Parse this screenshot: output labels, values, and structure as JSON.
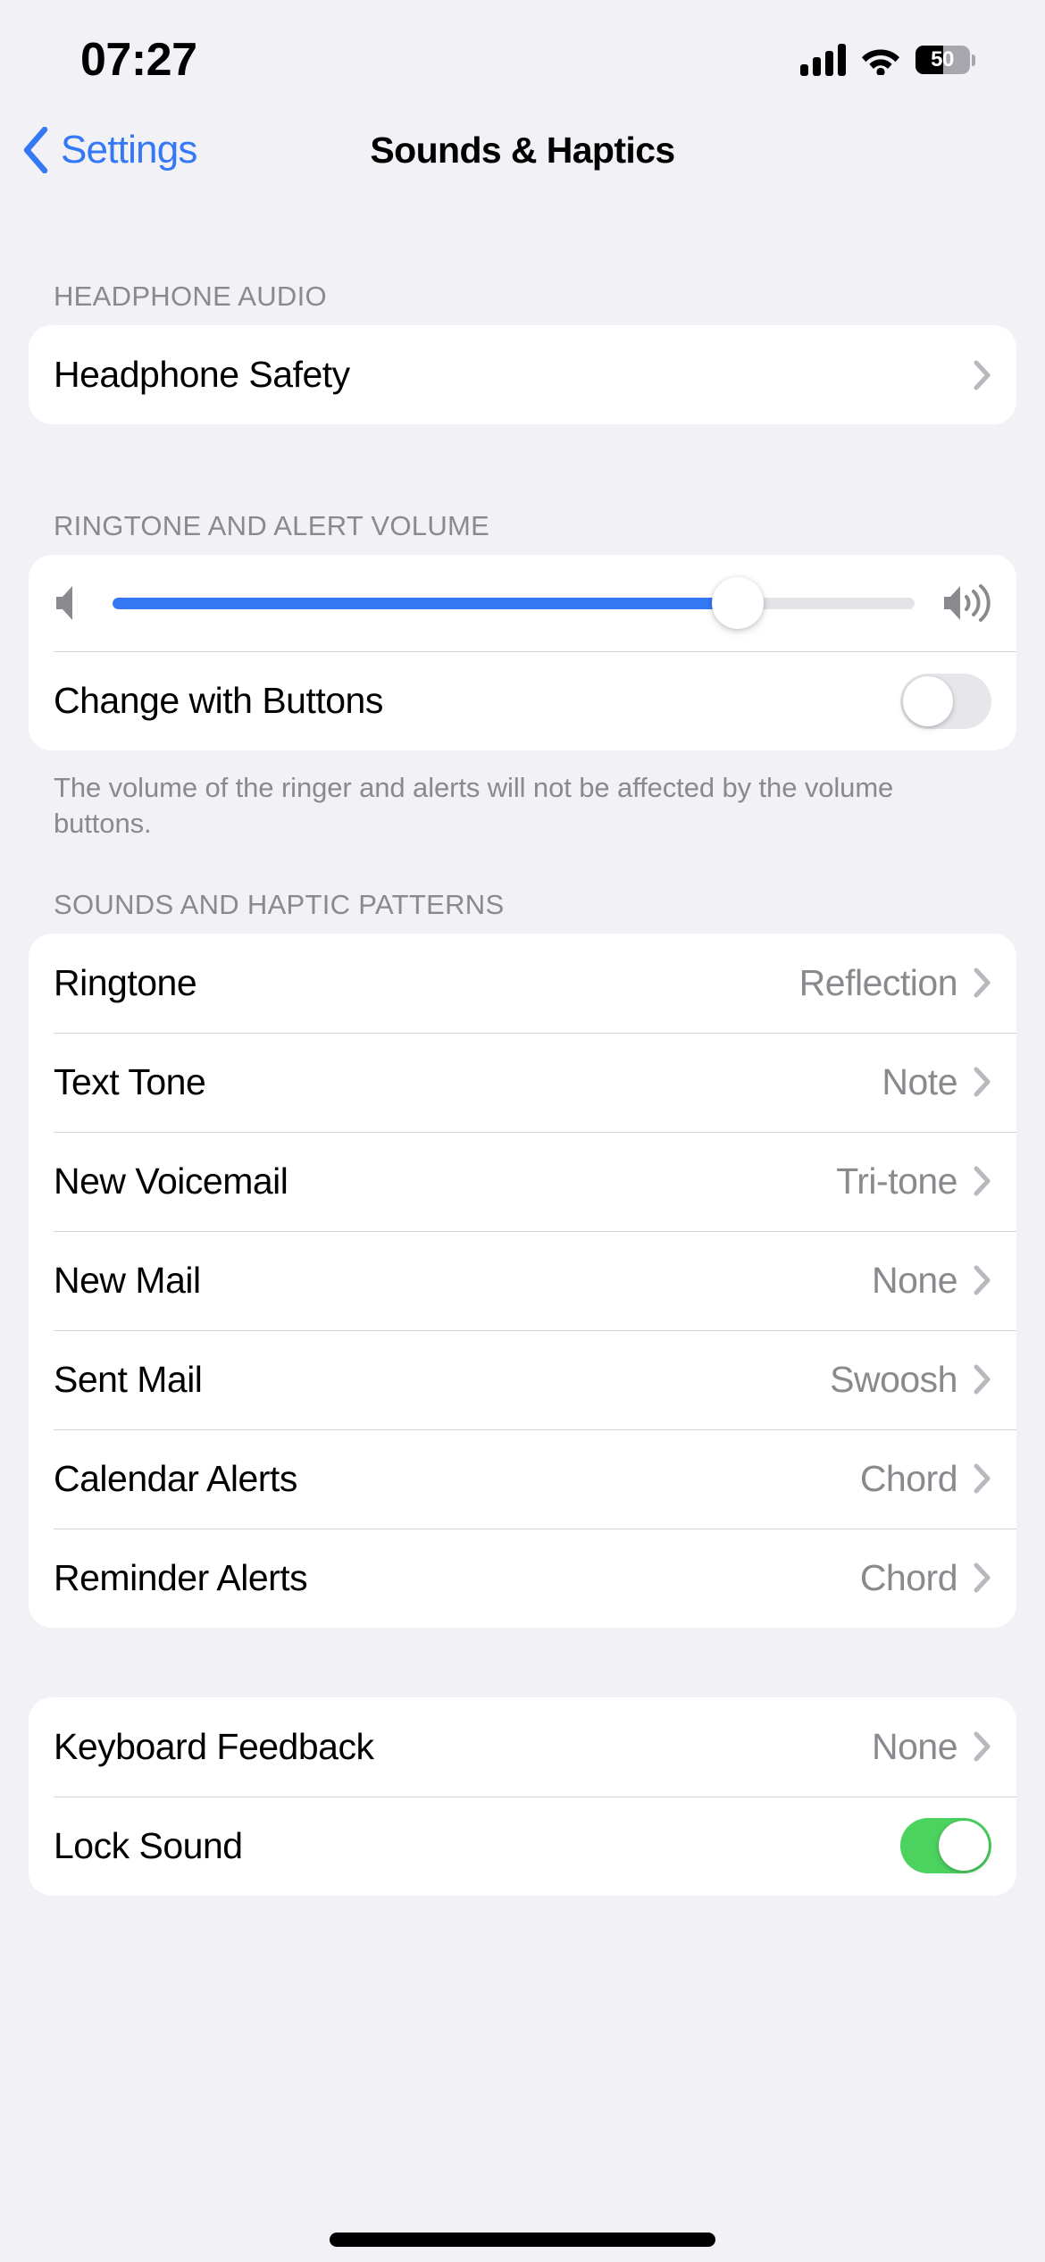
{
  "status_bar": {
    "time": "07:27",
    "battery_percent": "50",
    "battery_level_fraction": 0.5,
    "cellular_icon": "cellular-bars-icon",
    "wifi_icon": "wifi-icon",
    "battery_icon": "battery-icon"
  },
  "nav": {
    "back_label": "Settings",
    "back_icon": "chevron-left-icon",
    "title": "Sounds & Haptics"
  },
  "sections": {
    "headphone_audio": {
      "header": "HEADPHONE AUDIO",
      "rows": [
        {
          "label": "Headphone Safety",
          "value": "",
          "accessory": "chevron-right-icon"
        }
      ]
    },
    "ringtone_volume": {
      "header": "RINGTONE AND ALERT VOLUME",
      "slider": {
        "value_percent": 78,
        "min_icon": "speaker-low-icon",
        "max_icon": "speaker-high-icon",
        "fill_color": "#3478f6",
        "track_color": "#e3e3e8"
      },
      "toggle_row": {
        "label": "Change with Buttons",
        "state": "off",
        "off_color": "#e6e6eb"
      },
      "footer": "The volume of the ringer and alerts will not be affected by the volume buttons."
    },
    "sounds_haptics": {
      "header": "SOUNDS AND HAPTIC PATTERNS",
      "rows": [
        {
          "label": "Ringtone",
          "value": "Reflection",
          "accessory": "chevron-right-icon"
        },
        {
          "label": "Text Tone",
          "value": "Note",
          "accessory": "chevron-right-icon"
        },
        {
          "label": "New Voicemail",
          "value": "Tri-tone",
          "accessory": "chevron-right-icon"
        },
        {
          "label": "New Mail",
          "value": "None",
          "accessory": "chevron-right-icon"
        },
        {
          "label": "Sent Mail",
          "value": "Swoosh",
          "accessory": "chevron-right-icon"
        },
        {
          "label": "Calendar Alerts",
          "value": "Chord",
          "accessory": "chevron-right-icon"
        },
        {
          "label": "Reminder Alerts",
          "value": "Chord",
          "accessory": "chevron-right-icon"
        }
      ]
    },
    "feedback": {
      "header": "",
      "rows": [
        {
          "label": "Keyboard Feedback",
          "value": "None",
          "accessory": "chevron-right-icon"
        }
      ],
      "lock_sound_row": {
        "label": "Lock Sound",
        "state": "on",
        "on_color": "#4cd25f"
      }
    }
  },
  "colors": {
    "page_background": "#f1f1f6",
    "card_background": "#ffffff",
    "accent_blue": "#3478f6",
    "secondary_text": "#8a8a8e",
    "separator": "#d3d3d8",
    "primary_text": "#000000"
  }
}
